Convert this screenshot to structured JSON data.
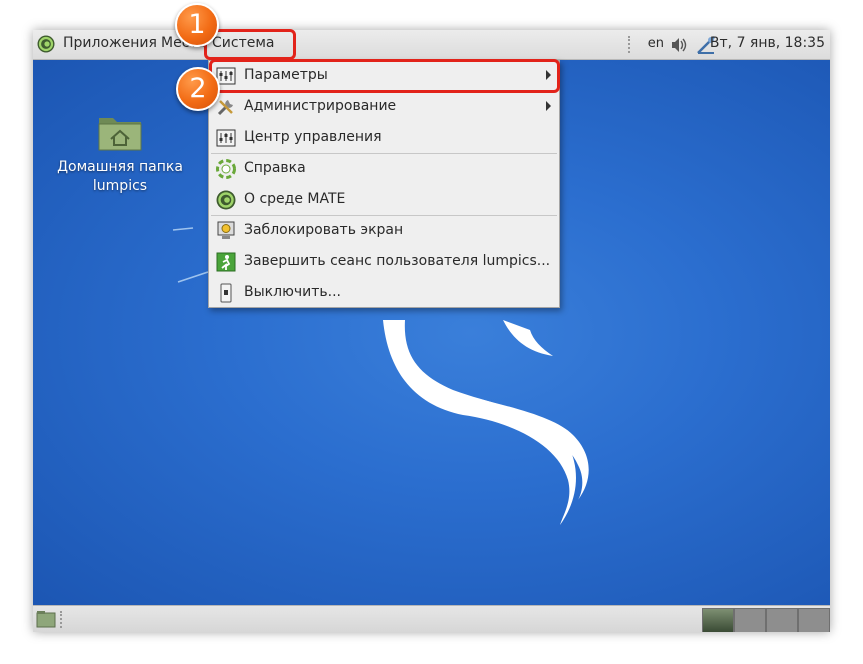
{
  "top_panel": {
    "menus": [
      "Приложения",
      "Места",
      "Система"
    ],
    "keyboard_layout": "en",
    "clock": "Вт, 7 янв, 18:35"
  },
  "desktop": {
    "home_folder_label_line1": "Домашняя папка",
    "home_folder_label_line2": "lumpics"
  },
  "system_menu": {
    "items": [
      {
        "label": "Параметры",
        "icon": "preferences-icon",
        "submenu": true
      },
      {
        "label": "Администрирование",
        "icon": "administration-icon",
        "submenu": true
      },
      {
        "label": "Центр управления",
        "icon": "control-center-icon",
        "submenu": false
      },
      {
        "label": "Справка",
        "icon": "help-icon",
        "submenu": false
      },
      {
        "label": "О среде MATE",
        "icon": "mate-logo-icon",
        "submenu": false
      },
      {
        "label": "Заблокировать экран",
        "icon": "lock-screen-icon",
        "submenu": false
      },
      {
        "label": "Завершить сеанс пользователя lumpics...",
        "icon": "logout-icon",
        "submenu": false
      },
      {
        "label": "Выключить...",
        "icon": "shutdown-icon",
        "submenu": false
      }
    ]
  },
  "annotations": {
    "step1": "1",
    "step2": "2"
  },
  "colors": {
    "desktop_blue": "#2b6ecf",
    "highlight_red": "#e2231a",
    "badge_orange": "#f26b14",
    "panel_gray": "#e2e2e2"
  }
}
